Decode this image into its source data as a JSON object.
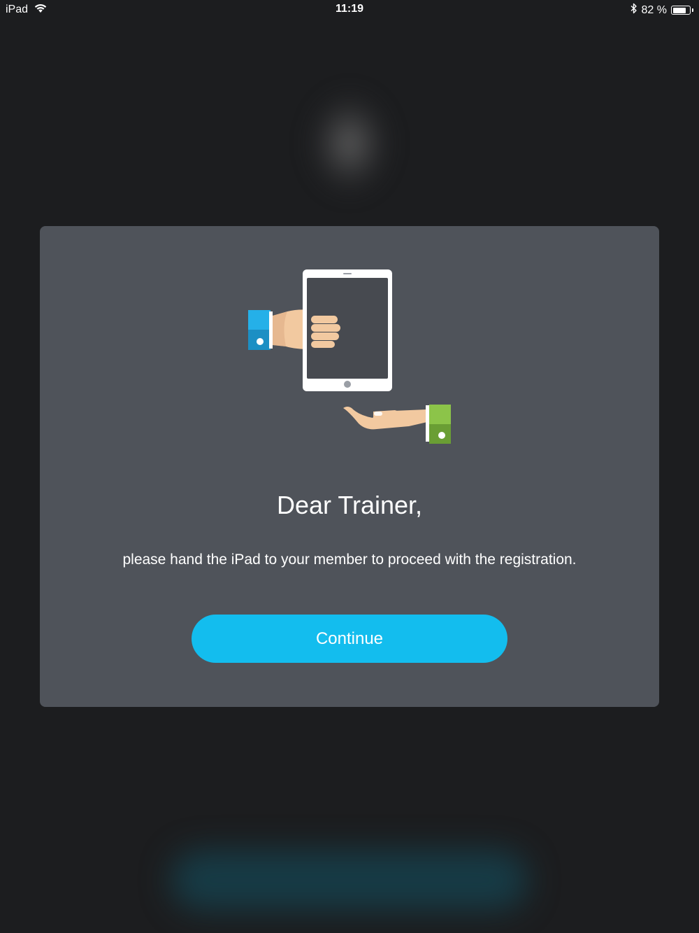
{
  "status_bar": {
    "device": "iPad",
    "time": "11:19",
    "battery_percent": "82 %",
    "battery_level": 0.82,
    "icons": [
      "wifi-icon",
      "bluetooth-icon",
      "battery-icon"
    ]
  },
  "modal": {
    "illustration": "hand-over-ipad-illustration",
    "title": "Dear Trainer,",
    "message": "please hand the iPad to your member to proceed with the registration.",
    "continue_label": "Continue"
  },
  "colors": {
    "background": "#1c1d1f",
    "modal_background": "#4f535a",
    "accent": "#13bdee",
    "sleeve_blue": "#1fa8e0",
    "sleeve_green": "#7bb53f",
    "skin": "#f2c9a0"
  }
}
